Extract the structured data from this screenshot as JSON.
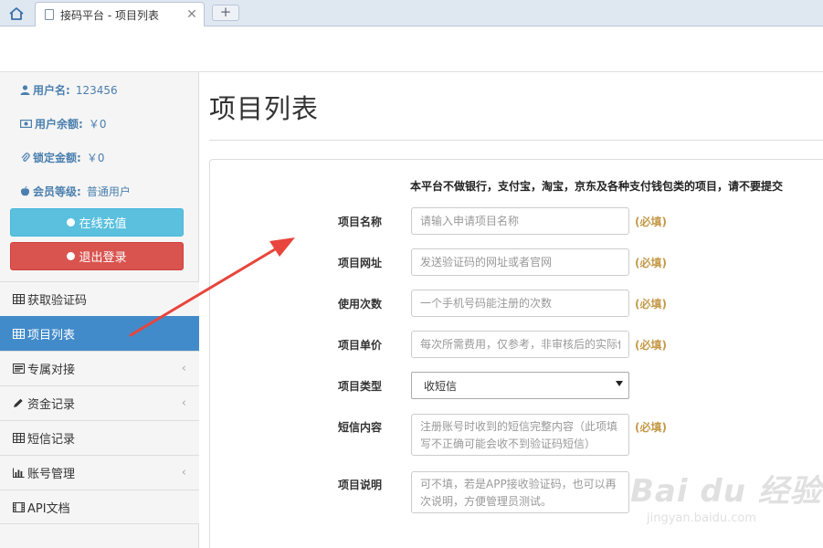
{
  "browser": {
    "tab_title": "接码平台 - 项目列表",
    "close_glyph": "✕",
    "new_tab_glyph": "+"
  },
  "user": {
    "name_label": "用户名:",
    "name_value": "123456",
    "balance_label": "用户余额:",
    "balance_value": "￥0",
    "locked_label": "锁定金额:",
    "locked_value": "￥0",
    "level_label": "会员等级:",
    "level_value": "普通用户"
  },
  "actions": {
    "recharge": "在线充值",
    "logout": "退出登录"
  },
  "nav": {
    "items": [
      {
        "label": "获取验证码",
        "icon": "table-icon",
        "chevron": ""
      },
      {
        "label": "项目列表",
        "icon": "table-icon",
        "chevron": "",
        "active": true
      },
      {
        "label": "专属对接",
        "icon": "list-icon",
        "chevron": "‹"
      },
      {
        "label": "资金记录",
        "icon": "pencil-icon",
        "chevron": "‹"
      },
      {
        "label": "短信记录",
        "icon": "table-icon",
        "chevron": ""
      },
      {
        "label": "账号管理",
        "icon": "bar-chart-icon",
        "chevron": "‹"
      },
      {
        "label": "API文档",
        "icon": "film-icon",
        "chevron": ""
      }
    ]
  },
  "main": {
    "page_title": "项目列表",
    "notice": "本平台不做银行，支付宝，淘宝，京东及各种支付钱包类的项目，请不要提交",
    "required_tag": "(必填)",
    "fields": {
      "name": {
        "label": "项目名称",
        "placeholder": "请输入申请项目名称"
      },
      "url": {
        "label": "项目网址",
        "placeholder": "发送验证码的网址或者官网"
      },
      "count": {
        "label": "使用次数",
        "placeholder": "一个手机号码能注册的次数"
      },
      "price": {
        "label": "项目单价",
        "placeholder": "每次所需费用，仅参考，非审核后的实际价格"
      },
      "type": {
        "label": "项目类型",
        "selected": "收短信"
      },
      "sms": {
        "label": "短信内容",
        "placeholder": "注册账号时收到的短信完整内容（此项填写不正确可能会收不到验证码短信）"
      },
      "desc": {
        "label": "项目说明",
        "placeholder": "可不填，若是APP接收验证码，也可以再次说明，方便管理员测试。"
      }
    }
  },
  "watermark": {
    "line1": "Bai du 经验",
    "line2": "jingyan.baidu.com"
  },
  "colors": {
    "active_nav": "#428bca",
    "recharge": "#5bc0de",
    "logout": "#d9534f",
    "required": "#c49a4a",
    "arrow": "#e8453c"
  }
}
